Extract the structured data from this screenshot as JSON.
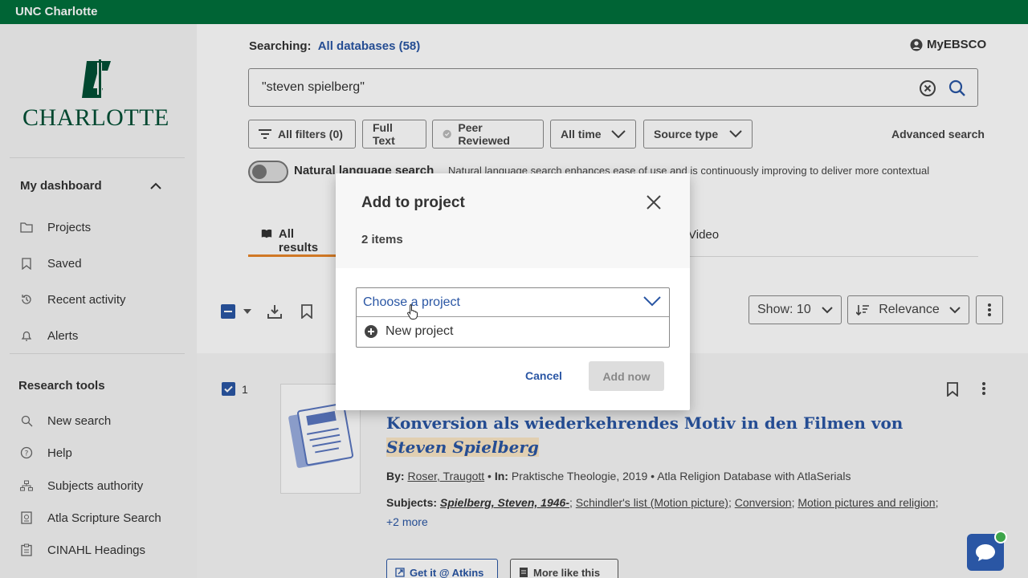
{
  "topbar": {
    "title": "UNC Charlotte"
  },
  "logo": {
    "text": "CHARLOTTE"
  },
  "sidebar": {
    "dashboard_heading": "My dashboard",
    "dashboard_items": [
      {
        "label": "Projects",
        "icon": "folder-icon"
      },
      {
        "label": "Saved",
        "icon": "bookmark-icon"
      },
      {
        "label": "Recent activity",
        "icon": "history-icon"
      },
      {
        "label": "Alerts",
        "icon": "bell-icon"
      }
    ],
    "tools_heading": "Research tools",
    "tools_items": [
      {
        "label": "New search",
        "icon": "search-icon"
      },
      {
        "label": "Help",
        "icon": "help-icon"
      },
      {
        "label": "Subjects authority",
        "icon": "hierarchy-icon"
      },
      {
        "label": "Atla Scripture Search",
        "icon": "book-search-icon"
      },
      {
        "label": "CINAHL Headings",
        "icon": "clipboard-icon"
      }
    ]
  },
  "header": {
    "searching_label": "Searching:",
    "databases_link": "All databases (58)",
    "account_label": "MyEBSCO"
  },
  "search": {
    "query": "\"steven spielberg\""
  },
  "filters": {
    "all_filters": "All filters (0)",
    "full_text": "Full Text",
    "peer_reviewed": "Peer Reviewed",
    "all_time": "All time",
    "source_type": "Source type",
    "advanced": "Advanced search"
  },
  "natural_language": {
    "label": "Natural language search",
    "description": "Natural language search enhances ease of use and is continuously improving to deliver more contextual"
  },
  "tabs": {
    "all_results": "All results",
    "video": "Video"
  },
  "controls": {
    "show": "Show: 10",
    "sort": "Relevance"
  },
  "result": {
    "number": "1",
    "title_main": "Konversion als wiederkehrendes Motiv in den Filmen von ",
    "title_highlight": "Steven Spielberg",
    "by_label": "By:",
    "author": "Roser, Traugott",
    "in_label": "In:",
    "source": "Praktische Theologie, 2019",
    "database": "Atla Religion Database with AtlaSerials",
    "subjects_label": "Subjects:",
    "subject_1": "Spielberg, Steven, 1946-",
    "subject_2": "Schindler's list (Motion picture)",
    "subject_3": "Conversion",
    "subject_4": "Motion pictures and religion",
    "more": "+2 more",
    "btn_get": "Get it @ Atkins",
    "btn_more": "More like this"
  },
  "modal": {
    "title": "Add to project",
    "subtitle": "2 items",
    "dropdown_label": "Choose a project",
    "option_new": "New project",
    "cancel": "Cancel",
    "add": "Add now"
  }
}
